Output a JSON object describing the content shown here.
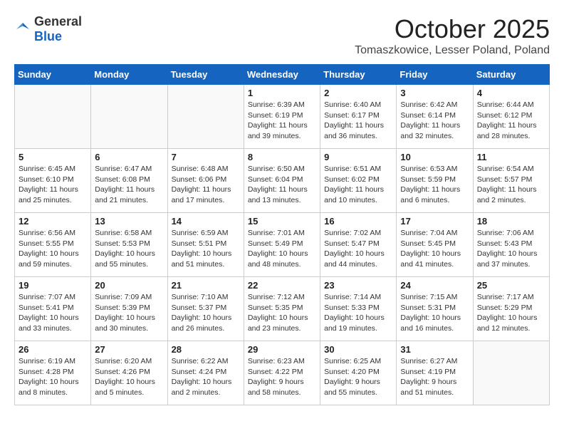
{
  "header": {
    "logo_general": "General",
    "logo_blue": "Blue",
    "month_title": "October 2025",
    "location": "Tomaszkowice, Lesser Poland, Poland"
  },
  "weekdays": [
    "Sunday",
    "Monday",
    "Tuesday",
    "Wednesday",
    "Thursday",
    "Friday",
    "Saturday"
  ],
  "weeks": [
    [
      {
        "day": "",
        "info": ""
      },
      {
        "day": "",
        "info": ""
      },
      {
        "day": "",
        "info": ""
      },
      {
        "day": "1",
        "info": "Sunrise: 6:39 AM\nSunset: 6:19 PM\nDaylight: 11 hours\nand 39 minutes."
      },
      {
        "day": "2",
        "info": "Sunrise: 6:40 AM\nSunset: 6:17 PM\nDaylight: 11 hours\nand 36 minutes."
      },
      {
        "day": "3",
        "info": "Sunrise: 6:42 AM\nSunset: 6:14 PM\nDaylight: 11 hours\nand 32 minutes."
      },
      {
        "day": "4",
        "info": "Sunrise: 6:44 AM\nSunset: 6:12 PM\nDaylight: 11 hours\nand 28 minutes."
      }
    ],
    [
      {
        "day": "5",
        "info": "Sunrise: 6:45 AM\nSunset: 6:10 PM\nDaylight: 11 hours\nand 25 minutes."
      },
      {
        "day": "6",
        "info": "Sunrise: 6:47 AM\nSunset: 6:08 PM\nDaylight: 11 hours\nand 21 minutes."
      },
      {
        "day": "7",
        "info": "Sunrise: 6:48 AM\nSunset: 6:06 PM\nDaylight: 11 hours\nand 17 minutes."
      },
      {
        "day": "8",
        "info": "Sunrise: 6:50 AM\nSunset: 6:04 PM\nDaylight: 11 hours\nand 13 minutes."
      },
      {
        "day": "9",
        "info": "Sunrise: 6:51 AM\nSunset: 6:02 PM\nDaylight: 11 hours\nand 10 minutes."
      },
      {
        "day": "10",
        "info": "Sunrise: 6:53 AM\nSunset: 5:59 PM\nDaylight: 11 hours\nand 6 minutes."
      },
      {
        "day": "11",
        "info": "Sunrise: 6:54 AM\nSunset: 5:57 PM\nDaylight: 11 hours\nand 2 minutes."
      }
    ],
    [
      {
        "day": "12",
        "info": "Sunrise: 6:56 AM\nSunset: 5:55 PM\nDaylight: 10 hours\nand 59 minutes."
      },
      {
        "day": "13",
        "info": "Sunrise: 6:58 AM\nSunset: 5:53 PM\nDaylight: 10 hours\nand 55 minutes."
      },
      {
        "day": "14",
        "info": "Sunrise: 6:59 AM\nSunset: 5:51 PM\nDaylight: 10 hours\nand 51 minutes."
      },
      {
        "day": "15",
        "info": "Sunrise: 7:01 AM\nSunset: 5:49 PM\nDaylight: 10 hours\nand 48 minutes."
      },
      {
        "day": "16",
        "info": "Sunrise: 7:02 AM\nSunset: 5:47 PM\nDaylight: 10 hours\nand 44 minutes."
      },
      {
        "day": "17",
        "info": "Sunrise: 7:04 AM\nSunset: 5:45 PM\nDaylight: 10 hours\nand 41 minutes."
      },
      {
        "day": "18",
        "info": "Sunrise: 7:06 AM\nSunset: 5:43 PM\nDaylight: 10 hours\nand 37 minutes."
      }
    ],
    [
      {
        "day": "19",
        "info": "Sunrise: 7:07 AM\nSunset: 5:41 PM\nDaylight: 10 hours\nand 33 minutes."
      },
      {
        "day": "20",
        "info": "Sunrise: 7:09 AM\nSunset: 5:39 PM\nDaylight: 10 hours\nand 30 minutes."
      },
      {
        "day": "21",
        "info": "Sunrise: 7:10 AM\nSunset: 5:37 PM\nDaylight: 10 hours\nand 26 minutes."
      },
      {
        "day": "22",
        "info": "Sunrise: 7:12 AM\nSunset: 5:35 PM\nDaylight: 10 hours\nand 23 minutes."
      },
      {
        "day": "23",
        "info": "Sunrise: 7:14 AM\nSunset: 5:33 PM\nDaylight: 10 hours\nand 19 minutes."
      },
      {
        "day": "24",
        "info": "Sunrise: 7:15 AM\nSunset: 5:31 PM\nDaylight: 10 hours\nand 16 minutes."
      },
      {
        "day": "25",
        "info": "Sunrise: 7:17 AM\nSunset: 5:29 PM\nDaylight: 10 hours\nand 12 minutes."
      }
    ],
    [
      {
        "day": "26",
        "info": "Sunrise: 6:19 AM\nSunset: 4:28 PM\nDaylight: 10 hours\nand 8 minutes."
      },
      {
        "day": "27",
        "info": "Sunrise: 6:20 AM\nSunset: 4:26 PM\nDaylight: 10 hours\nand 5 minutes."
      },
      {
        "day": "28",
        "info": "Sunrise: 6:22 AM\nSunset: 4:24 PM\nDaylight: 10 hours\nand 2 minutes."
      },
      {
        "day": "29",
        "info": "Sunrise: 6:23 AM\nSunset: 4:22 PM\nDaylight: 9 hours\nand 58 minutes."
      },
      {
        "day": "30",
        "info": "Sunrise: 6:25 AM\nSunset: 4:20 PM\nDaylight: 9 hours\nand 55 minutes."
      },
      {
        "day": "31",
        "info": "Sunrise: 6:27 AM\nSunset: 4:19 PM\nDaylight: 9 hours\nand 51 minutes."
      },
      {
        "day": "",
        "info": ""
      }
    ]
  ]
}
